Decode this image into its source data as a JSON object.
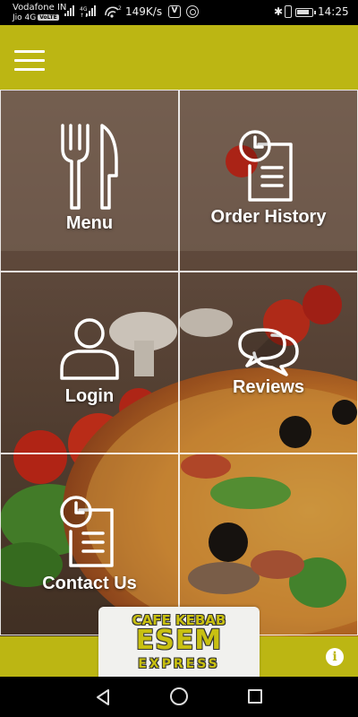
{
  "status_bar": {
    "carrier_primary": "Vodafone IN",
    "carrier_secondary": "Jio 4G",
    "volte_badge": "VoLTE",
    "net_type_line1": "4G",
    "net_type_line2": "↑↓",
    "hotspot_badge": "2",
    "net_speed": "149K/s",
    "app_icon_letter": "V",
    "bluetooth_glyph": "✱",
    "time": "14:25"
  },
  "app_bar": {
    "background_color": "#bcb613",
    "menu_icon": "hamburger-menu-icon"
  },
  "tiles": [
    {
      "label": "Menu",
      "icon": "fork-knife-icon"
    },
    {
      "label": "Order History",
      "icon": "clock-document-icon"
    },
    {
      "label": "Login",
      "icon": "user-icon"
    },
    {
      "label": "Reviews",
      "icon": "chat-bubbles-icon"
    },
    {
      "label": "Contact Us",
      "icon": "clock-document-icon"
    },
    {
      "label": "",
      "icon": ""
    }
  ],
  "logo": {
    "line1": "CAFE KEBAB",
    "line2": "ESEM",
    "line3": "EXPRESS",
    "color": "#c8c011"
  },
  "bottom_bar": {
    "info_glyph": "i"
  },
  "nav_bar": {
    "back_icon": "nav-back-icon",
    "home_icon": "nav-home-icon",
    "recent_icon": "nav-recent-icon"
  }
}
